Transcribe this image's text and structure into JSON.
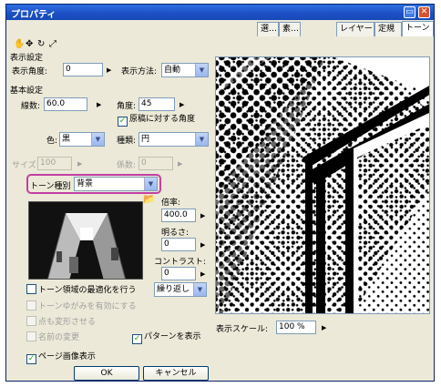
{
  "window": {
    "title": "プロパティ"
  },
  "tabs": [
    "選…",
    "素…",
    "レイヤー",
    "定規",
    "トーン"
  ],
  "display_settings": {
    "header": "表示設定",
    "angle_label": "表示角度:",
    "angle_value": "0",
    "method_label": "表示方法:",
    "method_value": "自動"
  },
  "basic_settings": {
    "header": "基本設定",
    "lines_label": "線数:",
    "lines_value": "60.0",
    "angle_label": "角度:",
    "angle_value": "45",
    "original_angle_label": "原稿に対する角度",
    "original_angle_checked": true,
    "color_label": "色:",
    "color_value": "黒",
    "type_label": "種類:",
    "type_value": "円",
    "size_label": "サイズ:",
    "size_value": "100",
    "coef_label": "係数:",
    "coef_value": "0"
  },
  "tone_type": {
    "label": "トーン種別",
    "value": "背景"
  },
  "scaling": {
    "scale_label": "倍率:",
    "scale_value": "400.0",
    "brightness_label": "明るさ:",
    "brightness_value": "0",
    "contrast_label": "コントラスト:",
    "contrast_value": "0",
    "repeat_value": "繰り返し"
  },
  "options": {
    "optimize_label": "トーン領域の最適化を行う",
    "distortion_label": "トーンゆがみを有効にする",
    "deform_points_label": "点も変形させる",
    "rename_label": "名前の変更",
    "show_pattern_label": "パターンを表示",
    "show_pattern_checked": true,
    "page_image_label": "ページ画像表示",
    "page_image_checked": true
  },
  "preview": {
    "scale_label": "表示スケール:",
    "scale_value": "100 %"
  },
  "buttons": {
    "ok": "OK",
    "cancel": "キャンセル"
  },
  "colors": {
    "accent_highlight": "#c23fa3",
    "titlebar": "#1d4fc4"
  }
}
